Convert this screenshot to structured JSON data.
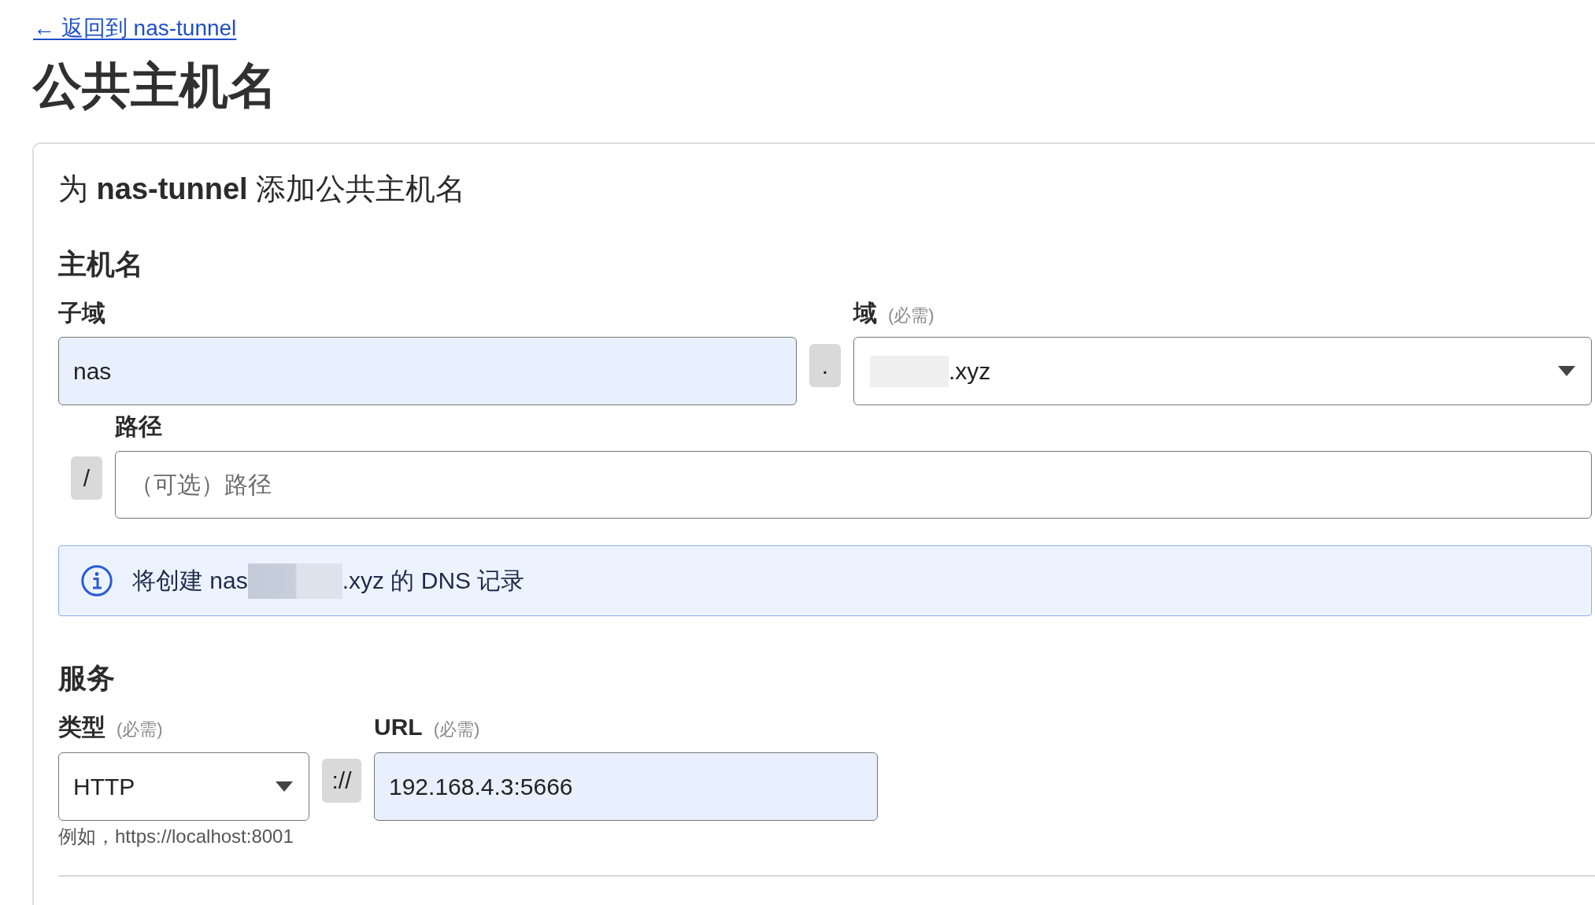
{
  "back_link": {
    "label": "← 返回到 nas-tunnel"
  },
  "page_title": "公共主机名",
  "card": {
    "heading": "为 **nas-tunnel** 添加公共主机名",
    "hostname": {
      "title": "主机名",
      "subdomain": {
        "label": "子域",
        "value": "nas",
        "autofilled": true
      },
      "separator": ".",
      "domain": {
        "label": "域",
        "hint": "(必需)",
        "value": ".xyz",
        "redacted": true
      },
      "path": {
        "label": "路径",
        "prefix": "/",
        "placeholder": "（可选）路径",
        "autofilled": false
      },
      "info": {
        "text_before": "将创建 nas",
        "redacted": true,
        "text_after": ".xyz 的 DNS 记录"
      }
    },
    "service": {
      "title": "服务",
      "type": {
        "label": "类型",
        "hint": "(必需)",
        "value": "HTTP",
        "example": "例如，https://localhost:8001"
      },
      "separator": "://",
      "url": {
        "label": "URL",
        "hint": "(必需)",
        "value": "192.168.4.3:5666",
        "autofilled": true
      }
    }
  }
}
